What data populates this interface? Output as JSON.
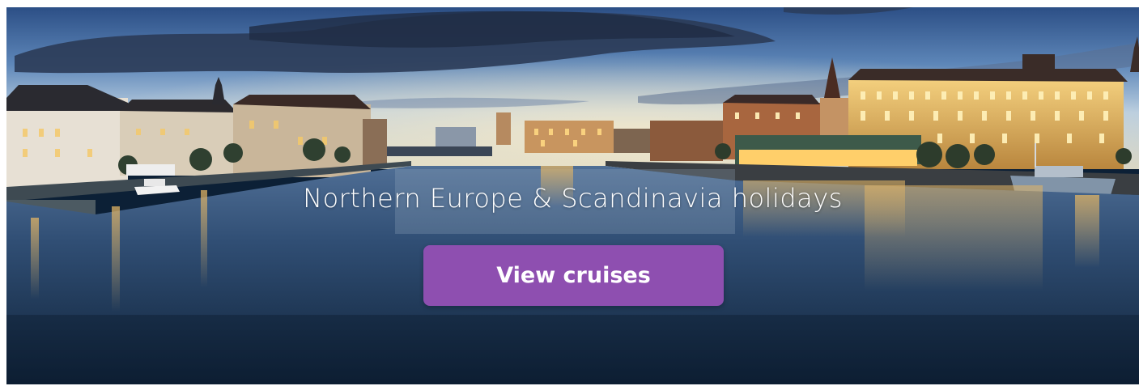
{
  "hero": {
    "title": "Northern Europe & Scandinavia holidays",
    "cta_label": "View cruises",
    "image_subject": "waterfront-city-at-dusk-photo"
  },
  "colors": {
    "cta_background": "#8e4fb0",
    "text": "#ffffff"
  }
}
